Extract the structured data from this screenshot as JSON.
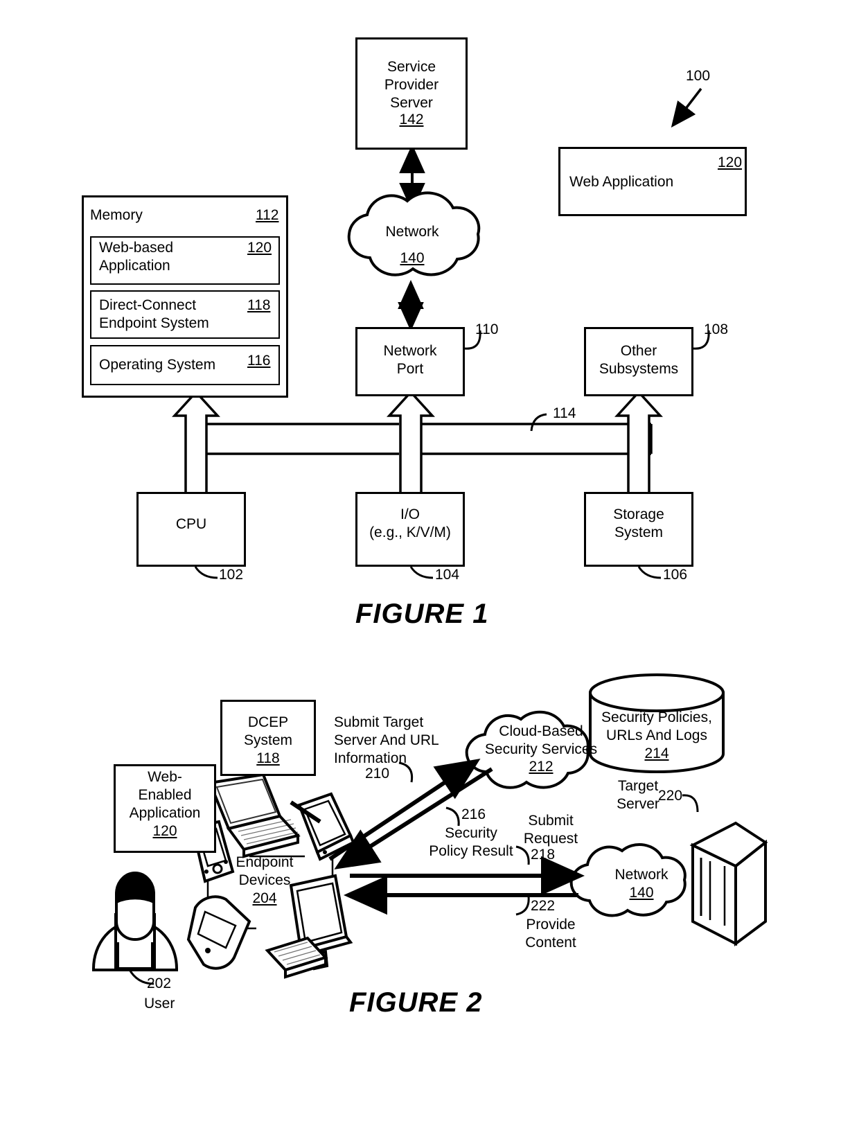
{
  "document": {
    "type": "patent-drawing-sheet",
    "figures": [
      "FIGURE 1",
      "FIGURE 2"
    ]
  },
  "figure1": {
    "caption": "FIGURE 1",
    "system_ref": "100",
    "blocks": {
      "service_provider_server": {
        "label": "Service\nProvider\nServer",
        "ref": "142"
      },
      "network_cloud": {
        "label": "Network",
        "ref": "140"
      },
      "web_application": {
        "label": "Web Application",
        "ref": "120"
      },
      "memory": {
        "label": "Memory",
        "ref": "112"
      },
      "web_based_application": {
        "label": "Web-based\nApplication",
        "ref": "120"
      },
      "direct_connect_endpoint_system": {
        "label": "Direct-Connect\nEndpoint System",
        "ref": "118"
      },
      "operating_system": {
        "label": "Operating System",
        "ref": "116"
      },
      "network_port": {
        "label": "Network\nPort",
        "ref": "110"
      },
      "other_subsystems": {
        "label": "Other\nSubsystems",
        "ref": "108"
      },
      "cpu": {
        "label": "CPU",
        "ref": "102"
      },
      "io": {
        "label": "I/O\n(e.g., K/V/M)",
        "ref": "104"
      },
      "storage_system": {
        "label": "Storage\nSystem",
        "ref": "106"
      },
      "bus": {
        "ref": "114"
      }
    }
  },
  "figure2": {
    "caption": "FIGURE 2",
    "blocks": {
      "dcep_system": {
        "label": "DCEP\nSystem",
        "ref": "118"
      },
      "web_enabled_application": {
        "label": "Web-\nEnabled\nApplication",
        "ref": "120"
      },
      "endpoint_devices": {
        "label": "Endpoint\nDevices",
        "ref": "204"
      },
      "user": {
        "label": "User",
        "ref": "202"
      },
      "cloud_based_security_services": {
        "label": "Cloud-Based\nSecurity Services",
        "ref": "212"
      },
      "security_policies_db": {
        "label": "Security Policies,\nURLs And Logs",
        "ref": "214"
      },
      "target_server": {
        "label": "Target\nServer",
        "ref": "220"
      },
      "network_cloud": {
        "label": "Network",
        "ref": "140"
      }
    },
    "flows": {
      "submit_target_server_url": {
        "label": "Submit Target\nServer And URL\nInformation",
        "ref": "210"
      },
      "security_policy_result": {
        "label": "Security\nPolicy Result",
        "ref": "216"
      },
      "submit_request": {
        "label": "Submit\nRequest",
        "ref": "218"
      },
      "provide_content": {
        "label": "Provide\nContent",
        "ref": "222"
      }
    }
  }
}
